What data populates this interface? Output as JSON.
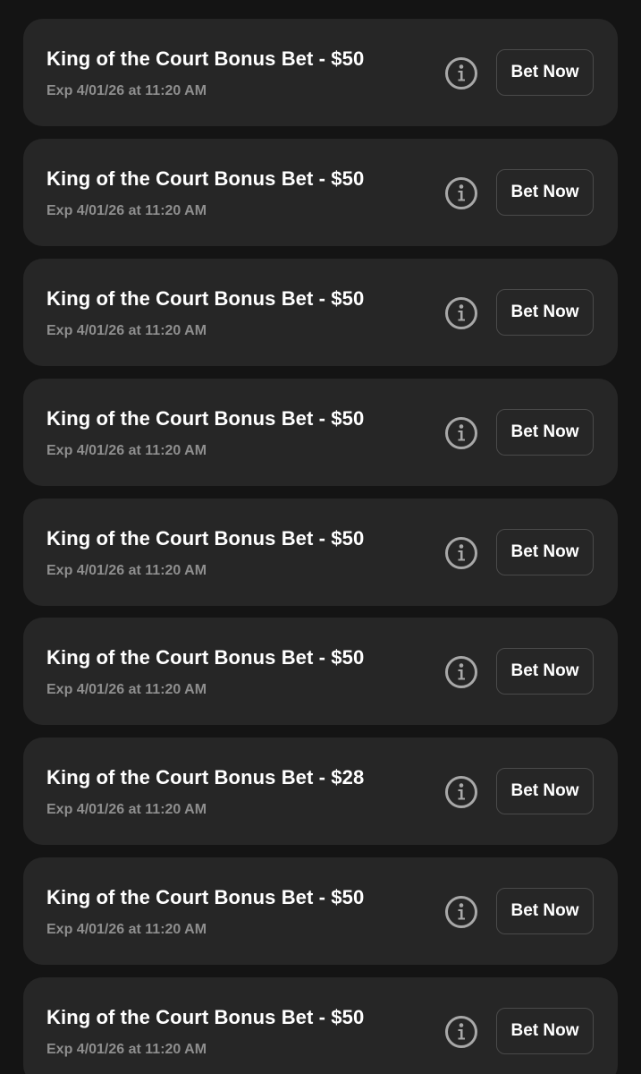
{
  "bonus_bets": [
    {
      "title": "King of the Court Bonus Bet - $50",
      "expires": "Exp 4/01/26 at 11:20 AM",
      "action_label": "Bet Now"
    },
    {
      "title": "King of the Court Bonus Bet - $50",
      "expires": "Exp 4/01/26 at 11:20 AM",
      "action_label": "Bet Now"
    },
    {
      "title": "King of the Court Bonus Bet - $50",
      "expires": "Exp 4/01/26 at 11:20 AM",
      "action_label": "Bet Now"
    },
    {
      "title": "King of the Court Bonus Bet - $50",
      "expires": "Exp 4/01/26 at 11:20 AM",
      "action_label": "Bet Now"
    },
    {
      "title": "King of the Court Bonus Bet - $50",
      "expires": "Exp 4/01/26 at 11:20 AM",
      "action_label": "Bet Now"
    },
    {
      "title": "King of the Court Bonus Bet - $50",
      "expires": "Exp 4/01/26 at 11:20 AM",
      "action_label": "Bet Now"
    },
    {
      "title": "King of the Court Bonus Bet - $28",
      "expires": "Exp 4/01/26 at 11:20 AM",
      "action_label": "Bet Now"
    },
    {
      "title": "King of the Court Bonus Bet - $50",
      "expires": "Exp 4/01/26 at 11:20 AM",
      "action_label": "Bet Now"
    },
    {
      "title": "King of the Court Bonus Bet - $50",
      "expires": "Exp 4/01/26 at 11:20 AM",
      "action_label": "Bet Now"
    }
  ],
  "icons": {
    "info": "info-circle-icon"
  },
  "colors": {
    "background": "#141414",
    "card": "#262626",
    "title_text": "#ffffff",
    "secondary_text": "#8e8e8e",
    "button_border": "#4a4a4a",
    "icon": "#a8a8a8"
  }
}
